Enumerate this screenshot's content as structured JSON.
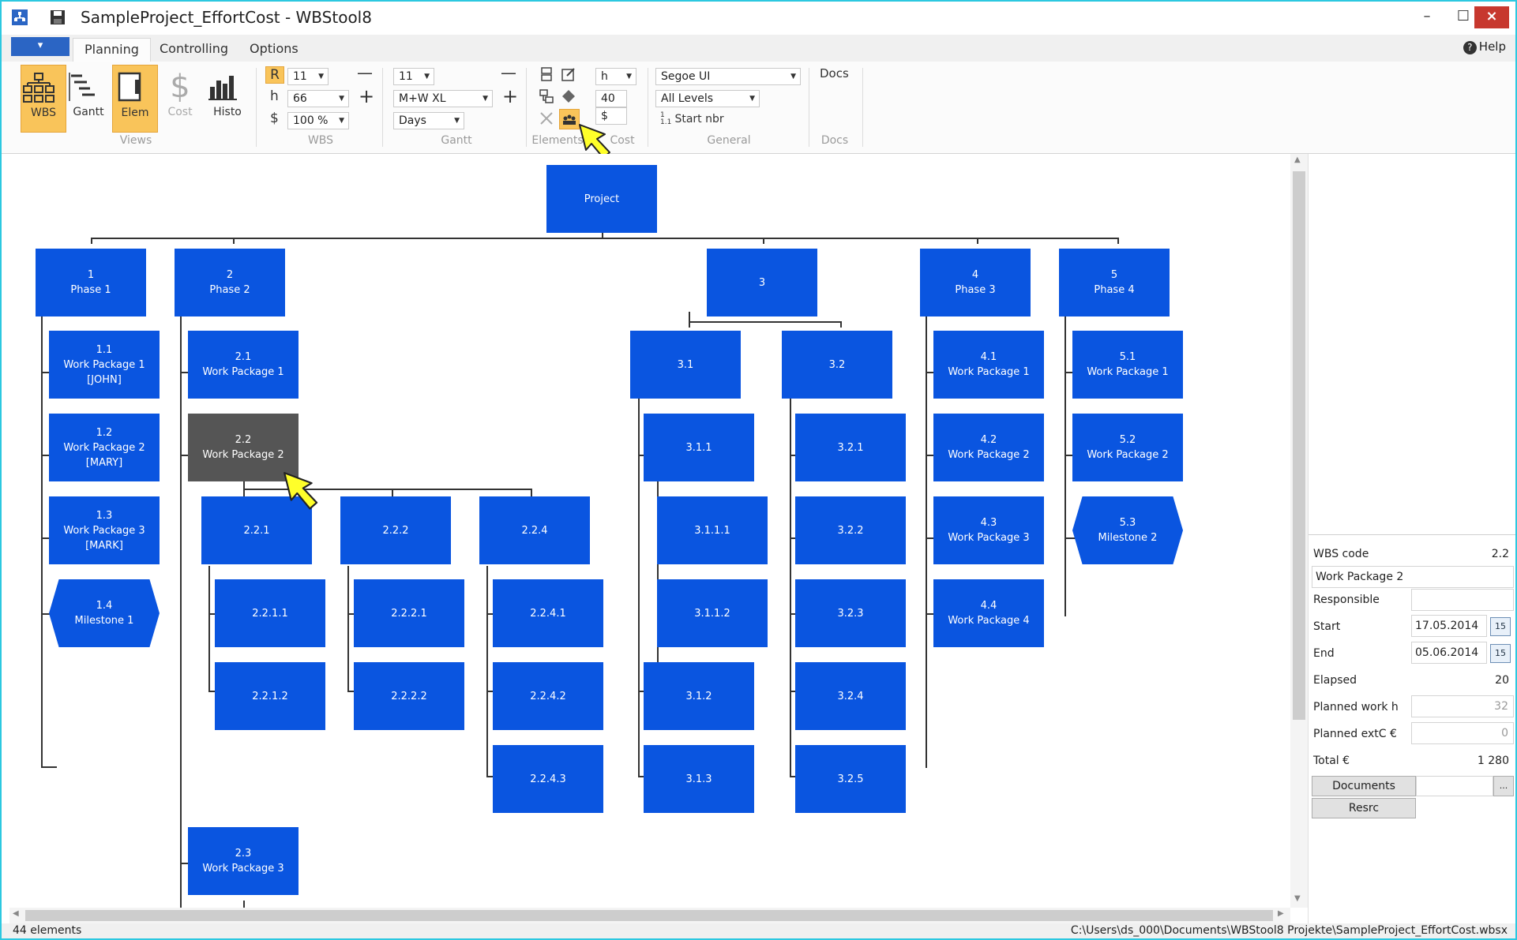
{
  "window": {
    "title": "SampleProject_EffortCost - WBStool8",
    "min": "–",
    "max": "☐",
    "close": "×"
  },
  "ribbon": {
    "file_menu": "▾",
    "tabs": [
      "Planning",
      "Controlling",
      "Options"
    ],
    "help": "Help",
    "views": {
      "label": "Views",
      "buttons": [
        "WBS",
        "Gantt",
        "Elem",
        "Cost",
        "Histo"
      ]
    },
    "wbs": {
      "label": "WBS",
      "r": "R",
      "h": "h",
      "dollar": "$",
      "font_size": "11",
      "height": "66",
      "zoom": "100 %"
    },
    "gantt": {
      "label": "Gantt",
      "font_size": "11",
      "scale": "M+W XL",
      "unit": "Days"
    },
    "elements": {
      "label": "Elements"
    },
    "cost": {
      "label": "Cost",
      "unit": "h",
      "hours": "40",
      "currency": "$"
    },
    "general": {
      "label": "General",
      "font": "Segoe UI",
      "levels": "All Levels",
      "start_nbr": "Start nbr"
    },
    "docs": {
      "label": "Docs",
      "button": "Docs"
    }
  },
  "wbs_nodes": {
    "project": "Project",
    "n1": [
      "1",
      "Phase 1"
    ],
    "n2": [
      "2",
      "Phase 2"
    ],
    "n3": [
      "3"
    ],
    "n4": [
      "4",
      "Phase 3"
    ],
    "n5": [
      "5",
      "Phase 4"
    ],
    "n1_1": [
      "1.1",
      "Work Package 1",
      "[JOHN]"
    ],
    "n1_2": [
      "1.2",
      "Work Package 2",
      "[MARY]"
    ],
    "n1_3": [
      "1.3",
      "Work Package 3",
      "[MARK]"
    ],
    "n1_4": [
      "1.4",
      "Milestone 1"
    ],
    "n2_1": [
      "2.1",
      "Work Package 1"
    ],
    "n2_2": [
      "2.2",
      "Work Package 2"
    ],
    "n2_3": [
      "2.3",
      "Work Package 3"
    ],
    "n2_2_1": [
      "2.2.1"
    ],
    "n2_2_2": [
      "2.2.2"
    ],
    "n2_2_4": [
      "2.2.4"
    ],
    "n2_2_1_1": [
      "2.2.1.1"
    ],
    "n2_2_1_2": [
      "2.2.1.2"
    ],
    "n2_2_2_1": [
      "2.2.2.1"
    ],
    "n2_2_2_2": [
      "2.2.2.2"
    ],
    "n2_2_4_1": [
      "2.2.4.1"
    ],
    "n2_2_4_2": [
      "2.2.4.2"
    ],
    "n2_2_4_3": [
      "2.2.4.3"
    ],
    "n3_1": [
      "3.1"
    ],
    "n3_2": [
      "3.2"
    ],
    "n3_1_1": [
      "3.1.1"
    ],
    "n3_1_1_1": [
      "3.1.1.1"
    ],
    "n3_1_1_2": [
      "3.1.1.2"
    ],
    "n3_1_2": [
      "3.1.2"
    ],
    "n3_1_3": [
      "3.1.3"
    ],
    "n3_2_1": [
      "3.2.1"
    ],
    "n3_2_2": [
      "3.2.2"
    ],
    "n3_2_3": [
      "3.2.3"
    ],
    "n3_2_4": [
      "3.2.4"
    ],
    "n3_2_5": [
      "3.2.5"
    ],
    "n4_1": [
      "4.1",
      "Work Package 1"
    ],
    "n4_2": [
      "4.2",
      "Work Package 2"
    ],
    "n4_3": [
      "4.3",
      "Work Package 3"
    ],
    "n4_4": [
      "4.4",
      "Work Package 4"
    ],
    "n5_1": [
      "5.1",
      "Work Package 1"
    ],
    "n5_2": [
      "5.2",
      "Work Package 2"
    ],
    "n5_3": [
      "5.3",
      "Milestone 2"
    ]
  },
  "properties": {
    "wbs_code_label": "WBS code",
    "wbs_code": "2.2",
    "name": "Work Package 2",
    "responsible_label": "Responsible",
    "start_label": "Start",
    "start": "17.05.2014",
    "end_label": "End",
    "end": "05.06.2014",
    "calendar_glyph": "15",
    "elapsed_label": "Elapsed",
    "elapsed": "20",
    "planned_work_label": "Planned work h",
    "planned_work": "32",
    "planned_extc_label": "Planned extC €",
    "planned_extc": "0",
    "total_label": "Total €",
    "total": "1 280",
    "documents_btn": "Documents",
    "documents_more": "...",
    "resrc_btn": "Resrc"
  },
  "status": {
    "elements": "44 elements",
    "path": "C:\\Users\\ds_000\\Documents\\WBStool8 Projekte\\SampleProject_EffortCost.wbsx"
  },
  "colors": {
    "node": "#0a55e0",
    "selected_node": "#555555",
    "active_button": "#f9c45a",
    "frame": "#2cc8e0"
  }
}
